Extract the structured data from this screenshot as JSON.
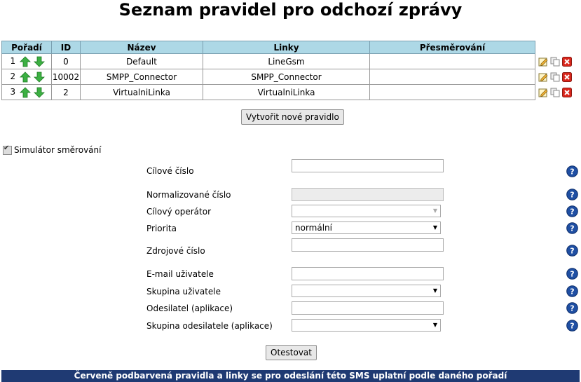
{
  "page": {
    "title": "Seznam pravidel pro odchozí zprávy"
  },
  "table": {
    "headers": [
      "Pořadí",
      "ID",
      "Název",
      "Linky",
      "Přesměrování"
    ],
    "rows": [
      {
        "order": "1",
        "id": "0",
        "name": "Default",
        "lines": "LineGsm",
        "redirect": ""
      },
      {
        "order": "2",
        "id": "10002",
        "name": "SMPP_Connector",
        "lines": "SMPP_Connector",
        "redirect": ""
      },
      {
        "order": "3",
        "id": "2",
        "name": "VirtualniLinka",
        "lines": "VirtualniLinka",
        "redirect": ""
      }
    ]
  },
  "buttons": {
    "create_rule": "Vytvořit nové pravidlo",
    "test": "Otestovat"
  },
  "simulator": {
    "label": "Simulátor směrování",
    "checked": true,
    "fields": {
      "target_number": {
        "label": "Cílové číslo",
        "value": ""
      },
      "normalized_number": {
        "label": "Normalizované číslo",
        "value": ""
      },
      "target_operator": {
        "label": "Cílový operátor",
        "value": ""
      },
      "priority": {
        "label": "Priorita",
        "value": "normální"
      },
      "source_number": {
        "label": "Zdrojové číslo",
        "value": ""
      },
      "user_email": {
        "label": "E-mail uživatele",
        "value": ""
      },
      "user_group": {
        "label": "Skupina uživatele",
        "value": ""
      },
      "sender_app": {
        "label": "Odesilatel (aplikace)",
        "value": ""
      },
      "sender_group_app": {
        "label": "Skupina odesilatele (aplikace)",
        "value": ""
      }
    }
  },
  "footer": {
    "note": "Červeně podbarvená pravidla a linky se pro odeslání této SMS uplatní podle daného pořadí"
  },
  "colors": {
    "header_bg": "#add8e6",
    "footer_bg": "#1f3a73",
    "arrow_green": "#3cb043",
    "delete_red": "#d9261c",
    "help_blue": "#1f4fa3"
  },
  "icons": [
    "arrow-up-icon",
    "arrow-down-icon",
    "edit-icon",
    "copy-icon",
    "delete-icon",
    "help-icon",
    "checkbox-icon"
  ]
}
